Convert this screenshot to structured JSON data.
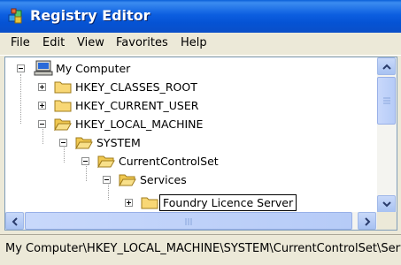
{
  "window": {
    "title": "Registry Editor",
    "title_icon": "registry-editor-icon"
  },
  "menu": [
    "File",
    "Edit",
    "View",
    "Favorites",
    "Help"
  ],
  "tree": {
    "root": {
      "label": "My Computer",
      "icon": "computer-icon"
    },
    "nodes": [
      {
        "label": "HKEY_CLASSES_ROOT",
        "expanded": false
      },
      {
        "label": "HKEY_CURRENT_USER",
        "expanded": false
      },
      {
        "label": "HKEY_LOCAL_MACHINE",
        "expanded": true
      },
      {
        "label": "SYSTEM",
        "expanded": true
      },
      {
        "label": "CurrentControlSet",
        "expanded": true
      },
      {
        "label": "Services",
        "expanded": true
      },
      {
        "label": "Foundry Licence Server",
        "expanded": false,
        "editing": true
      }
    ]
  },
  "statusbar": {
    "path": "My Computer\\HKEY_LOCAL_MACHINE\\SYSTEM\\CurrentControlSet\\Services"
  },
  "colors": {
    "titlebar": "#0553d4",
    "folder": "#f8d775",
    "scroll_button": "#b8cdf5"
  }
}
